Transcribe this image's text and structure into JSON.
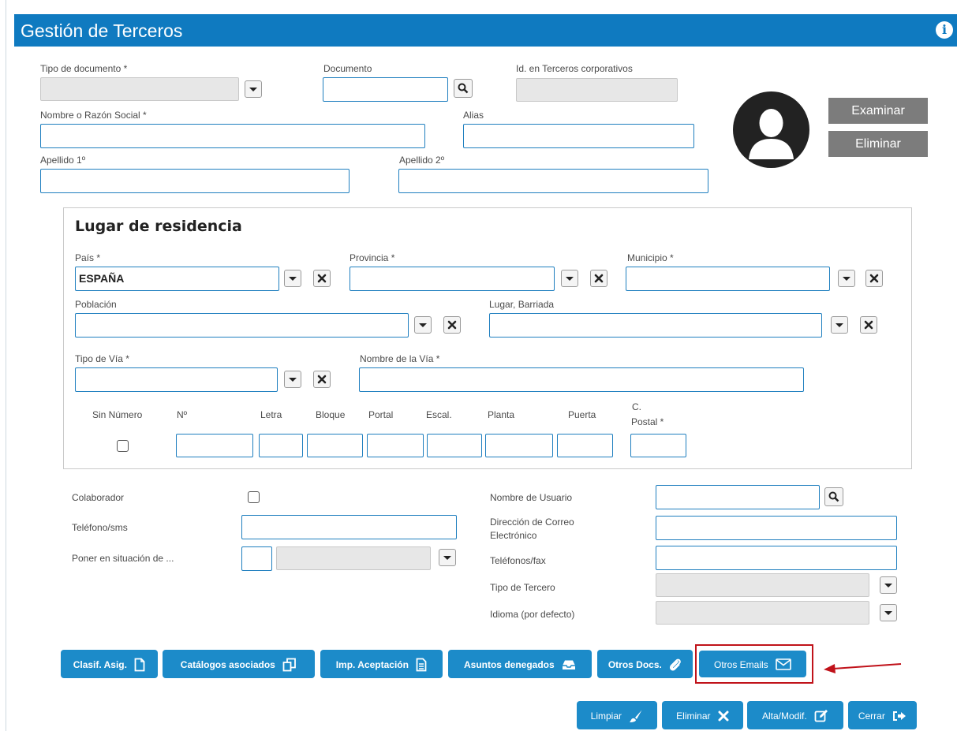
{
  "header": {
    "title": "Gestión de Terceros",
    "info_icon": "info-circle-icon",
    "color": "#0f7ac0"
  },
  "form": {
    "tipo_documento_label": "Tipo de documento *",
    "documento_label": "Documento",
    "id_terceros_label": "Id. en Terceros corporativos",
    "nombre_label": "Nombre o Razón Social *",
    "alias_label": "Alias",
    "apellido1_label": "Apellido 1º",
    "apellido2_label": "Apellido 2º"
  },
  "photo": {
    "examinar_label": "Examinar",
    "eliminar_label": "Eliminar"
  },
  "residencia": {
    "title": "Lugar de residencia",
    "pais_label": "País *",
    "pais_value": "ESPAÑA",
    "provincia_label": "Provincia *",
    "municipio_label": "Municipio *",
    "poblacion_label": "Población",
    "lugar_label": "Lugar, Barriada",
    "tipo_via_label": "Tipo de Vía *",
    "nombre_via_label": "Nombre de la Vía *",
    "sin_numero_label": "Sin Número",
    "numero_label": "Nº",
    "letra_label": "Letra",
    "bloque_label": "Bloque",
    "portal_label": "Portal",
    "escalera_label": "Escal.",
    "planta_label": "Planta",
    "puerta_label": "Puerta",
    "cpostal_label_1": "C.",
    "cpostal_label_2": "Postal *"
  },
  "extra": {
    "colaborador_label": "Colaborador",
    "telefono_label": "Teléfono/sms",
    "situacion_label": "Poner en situación de ...",
    "usuario_label": "Nombre de Usuario",
    "correo_label_1": "Dirección de Correo",
    "correo_label_2": "Electrónico",
    "telefonos_fax_label": "Teléfonos/fax",
    "tipo_tercero_label": "Tipo de Tercero",
    "idioma_label": "Idioma (por defecto)"
  },
  "actions": {
    "clasif": "Clasif. Asig.",
    "catalogos": "Catálogos asociados",
    "imp_aceptacion": "Imp. Aceptación",
    "asuntos": "Asuntos denegados",
    "otros_docs": "Otros Docs.",
    "otros_emails": "Otros Emails",
    "limpiar": "Limpiar",
    "eliminar": "Eliminar",
    "alta_modif": "Alta/Modif.",
    "cerrar": "Cerrar"
  },
  "colors": {
    "button_blue": "#1c8bc9",
    "highlight_red": "#c0121a",
    "gray_button": "#7c7c7c"
  }
}
